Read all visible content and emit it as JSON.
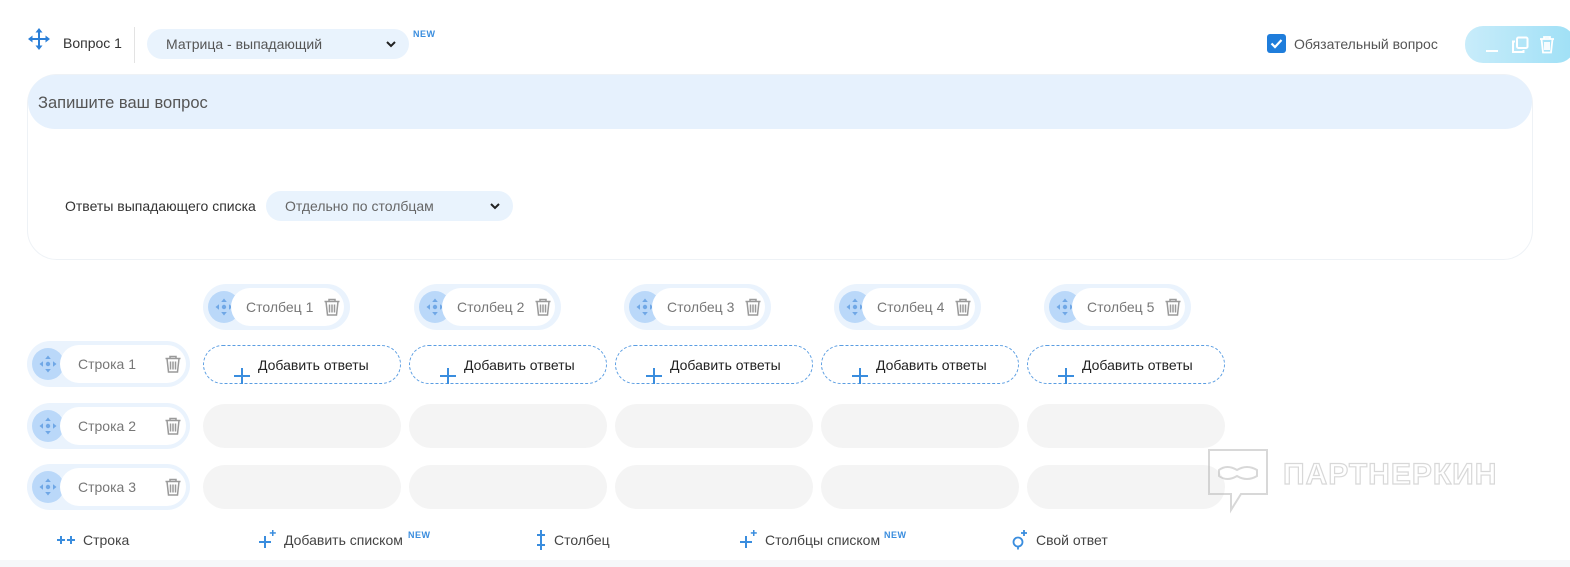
{
  "header": {
    "question_label": "Вопрос 1",
    "type_select_value": "Матрица - выпадающий",
    "new_badge": "NEW",
    "required_checked": true,
    "required_label": "Обязательный вопрос",
    "tools": [
      "minimize-icon",
      "duplicate-icon",
      "trash-icon"
    ]
  },
  "question": {
    "placeholder": "Запишите ваш вопрос",
    "dropdown_label": "Ответы выпадающего списка",
    "dropdown_value": "Отдельно по столбцам"
  },
  "matrix": {
    "columns": [
      "Столбец 1",
      "Столбец 2",
      "Столбец 3",
      "Столбец 4",
      "Столбец 5"
    ],
    "rows": [
      "Строка 1",
      "Строка 2",
      "Строка 3"
    ],
    "add_answers_label": "Добавить ответы"
  },
  "footer": {
    "add_row": "Строка",
    "add_list": "Добавить списком",
    "add_list_badge": "NEW",
    "add_column": "Столбец",
    "columns_list": "Столбцы списком",
    "columns_list_badge": "NEW",
    "own_answer": "Свой ответ"
  },
  "watermark": {
    "text": "ПАРТНЕРКИН"
  },
  "colors": {
    "accent": "#1f7ddb",
    "pill_bg": "#eaf3fd",
    "grip_bg": "#bad8f9",
    "empty_cell": "#f4f4f4"
  }
}
